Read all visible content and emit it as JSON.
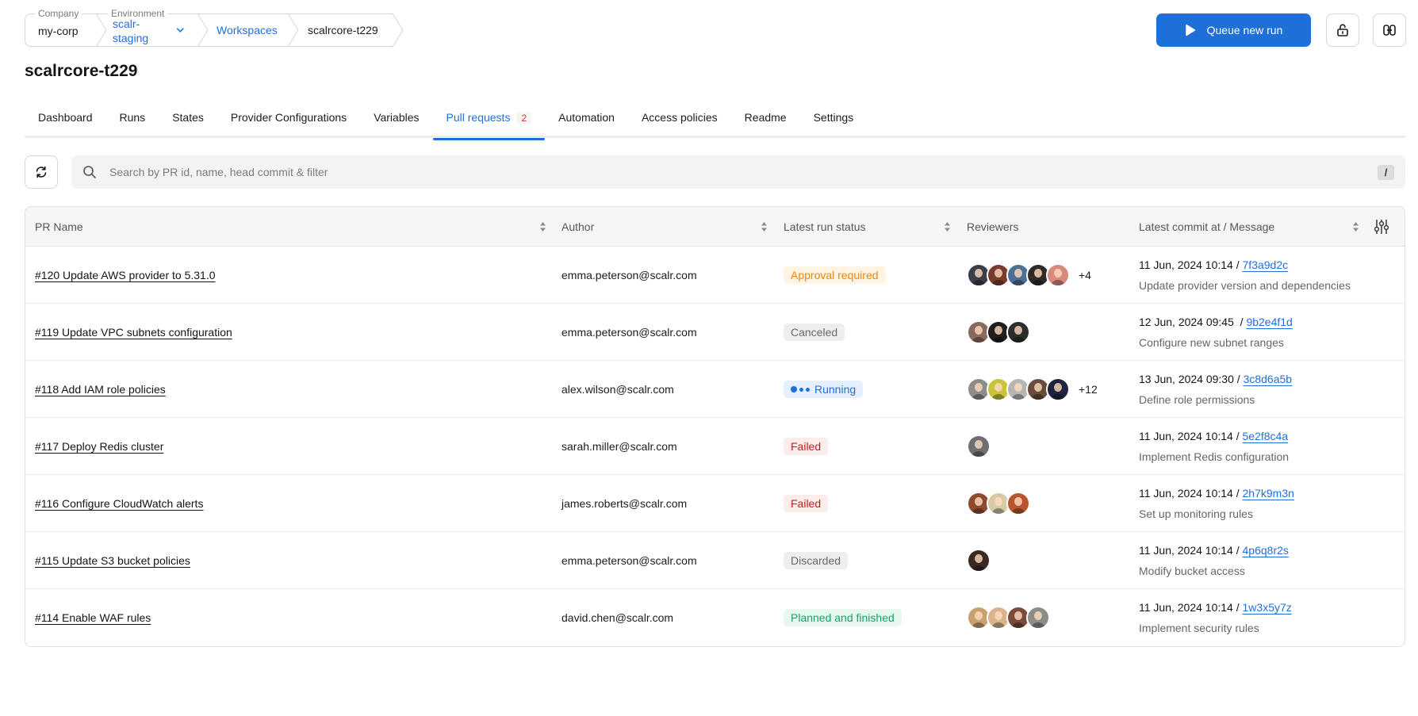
{
  "breadcrumb": {
    "company_label": "Company",
    "company_value": "my-corp",
    "environment_label": "Environment",
    "environment_value": "scalr-staging",
    "workspaces": "Workspaces",
    "current": "scalrcore-t229"
  },
  "actions": {
    "queue_run_label": "Queue new run"
  },
  "page_title": "scalrcore-t229",
  "tabs": [
    {
      "label": "Dashboard"
    },
    {
      "label": "Runs"
    },
    {
      "label": "States"
    },
    {
      "label": "Provider Configurations"
    },
    {
      "label": "Variables"
    },
    {
      "label": "Pull requests",
      "count": "2",
      "active": true
    },
    {
      "label": "Automation"
    },
    {
      "label": "Access policies"
    },
    {
      "label": "Readme"
    },
    {
      "label": "Settings"
    }
  ],
  "search": {
    "placeholder": "Search by PR id, name, head commit & filter",
    "shortcut": "/"
  },
  "table": {
    "columns": {
      "pr_name": "PR Name",
      "author": "Author",
      "status": "Latest run status",
      "reviewers": "Reviewers",
      "commit": "Latest commit at / Message"
    },
    "rows": [
      {
        "name": "#120 Update AWS provider to 5.31.0",
        "author": "emma.peterson@scalr.com",
        "status": "Approval required",
        "status_kind": "warning",
        "reviewers": [
          "#3b3f4a",
          "#7b3a2e",
          "#4d6f96",
          "#2f2a26",
          "#d98a7e"
        ],
        "reviewers_more": "+4",
        "commit_at": "11 Jun, 2024 10:14",
        "sha": "7f3a9d2c",
        "message": "Update provider version and dependencies"
      },
      {
        "name": "#119 Update VPC subnets configuration",
        "author": "emma.peterson@scalr.com",
        "status": "Canceled",
        "status_kind": "neutral",
        "reviewers": [
          "#8a6a5e",
          "#1e1e1e",
          "#2b2e2a"
        ],
        "reviewers_more": "",
        "commit_at": "12 Jun, 2024 09:45 ",
        "sha": "9b2e4f1d",
        "message": "Configure new subnet ranges"
      },
      {
        "name": "#118 Add IAM role policies",
        "author": "alex.wilson@scalr.com",
        "status": "Running",
        "status_kind": "running",
        "reviewers": [
          "#8c8c8c",
          "#c9c23a",
          "#b5b5b5",
          "#6a4a3a",
          "#1f2340"
        ],
        "reviewers_more": "+12",
        "commit_at": "13 Jun, 2024 09:30",
        "sha": "3c8d6a5b",
        "message": "Define role permissions"
      },
      {
        "name": "#117 Deploy Redis cluster",
        "author": "sarah.miller@scalr.com",
        "status": "Failed",
        "status_kind": "error",
        "reviewers": [
          "#6d6f73"
        ],
        "reviewers_more": "",
        "commit_at": "11 Jun, 2024 10:14",
        "sha": "5e2f8c4a",
        "message": "Implement Redis configuration"
      },
      {
        "name": "#116 Configure CloudWatch alerts",
        "author": "james.roberts@scalr.com",
        "status": "Failed",
        "status_kind": "error",
        "reviewers": [
          "#8e4a2e",
          "#d8c9a8",
          "#b8552e"
        ],
        "reviewers_more": "",
        "commit_at": "11 Jun, 2024 10:14",
        "sha": "2h7k9m3n",
        "message": "Set up monitoring rules"
      },
      {
        "name": "#115 Update S3 bucket policies",
        "author": "emma.peterson@scalr.com",
        "status": "Discarded",
        "status_kind": "neutral",
        "reviewers": [
          "#3a2a22"
        ],
        "reviewers_more": "",
        "commit_at": "11 Jun, 2024 10:14",
        "sha": "4p6q8r2s",
        "message": "Modify bucket access"
      },
      {
        "name": "#114 Enable WAF rules",
        "author": "david.chen@scalr.com",
        "status": "Planned and finished",
        "status_kind": "success",
        "reviewers": [
          "#c7a26e",
          "#d9b48f",
          "#7a4b3a",
          "#8b8e86"
        ],
        "reviewers_more": "",
        "commit_at": "11 Jun, 2024 10:14",
        "sha": "1w3x5y7z",
        "message": "Implement security rules"
      }
    ]
  },
  "colors": {
    "accent": "#1f6fd9",
    "warning_bg": "#fff3e3",
    "warning_fg": "#e8890c",
    "neutral_bg": "#eeeeee",
    "neutral_fg": "#6a6a6a",
    "running_bg": "#e6effd",
    "running_fg": "#1f6fd9",
    "error_bg": "#fdecec",
    "error_fg": "#c81d1d",
    "success_bg": "#e6f8ef",
    "success_fg": "#14a36b"
  },
  "icons": {
    "queue": "play-icon",
    "lock": "unlock-icon",
    "link": "link-icon",
    "refresh": "refresh-icon",
    "search": "search-icon",
    "column_settings": "sliders-icon"
  }
}
